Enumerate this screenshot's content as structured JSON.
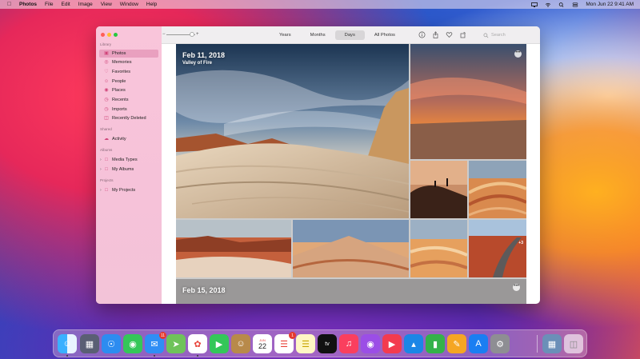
{
  "menubar": {
    "app_name": "Photos",
    "menus": [
      "File",
      "Edit",
      "Image",
      "View",
      "Window",
      "Help"
    ],
    "clock": "Mon Jun 22  9:41 AM"
  },
  "window": {
    "sidebar": {
      "sections": {
        "library": "Library",
        "shared": "Shared",
        "albums": "Albums",
        "projects": "Projects"
      },
      "items": [
        {
          "label": "Photos",
          "icon": "photos-icon"
        },
        {
          "label": "Memories",
          "icon": "memories-icon"
        },
        {
          "label": "Favorites",
          "icon": "heart-icon"
        },
        {
          "label": "People",
          "icon": "person-icon"
        },
        {
          "label": "Places",
          "icon": "pin-icon"
        },
        {
          "label": "Recents",
          "icon": "clock-icon"
        },
        {
          "label": "Imports",
          "icon": "clock-icon"
        },
        {
          "label": "Recently Deleted",
          "icon": "trash-icon"
        },
        {
          "label": "Activity",
          "icon": "cloud-icon"
        },
        {
          "label": "Media Types",
          "icon": "folder-icon"
        },
        {
          "label": "My Albums",
          "icon": "folder-icon"
        },
        {
          "label": "My Projects",
          "icon": "folder-icon"
        }
      ]
    },
    "toolbar": {
      "tabs": [
        "Years",
        "Months",
        "Days",
        "All Photos"
      ],
      "active_tab": "Days",
      "search_placeholder": "Search"
    },
    "content": {
      "group1_date": "Feb 11, 2018",
      "group1_place": "Valley of Fire",
      "group2_date": "Feb 15, 2018",
      "more_count": "+3"
    }
  },
  "dock": {
    "mail_badge": "11",
    "reminders_badge": "1",
    "calendar_month": "JUN",
    "calendar_day": "22",
    "tv_label": "tv"
  },
  "colors": {
    "sidebar_bg": "#f9c5da",
    "accent": "#d0457a"
  }
}
